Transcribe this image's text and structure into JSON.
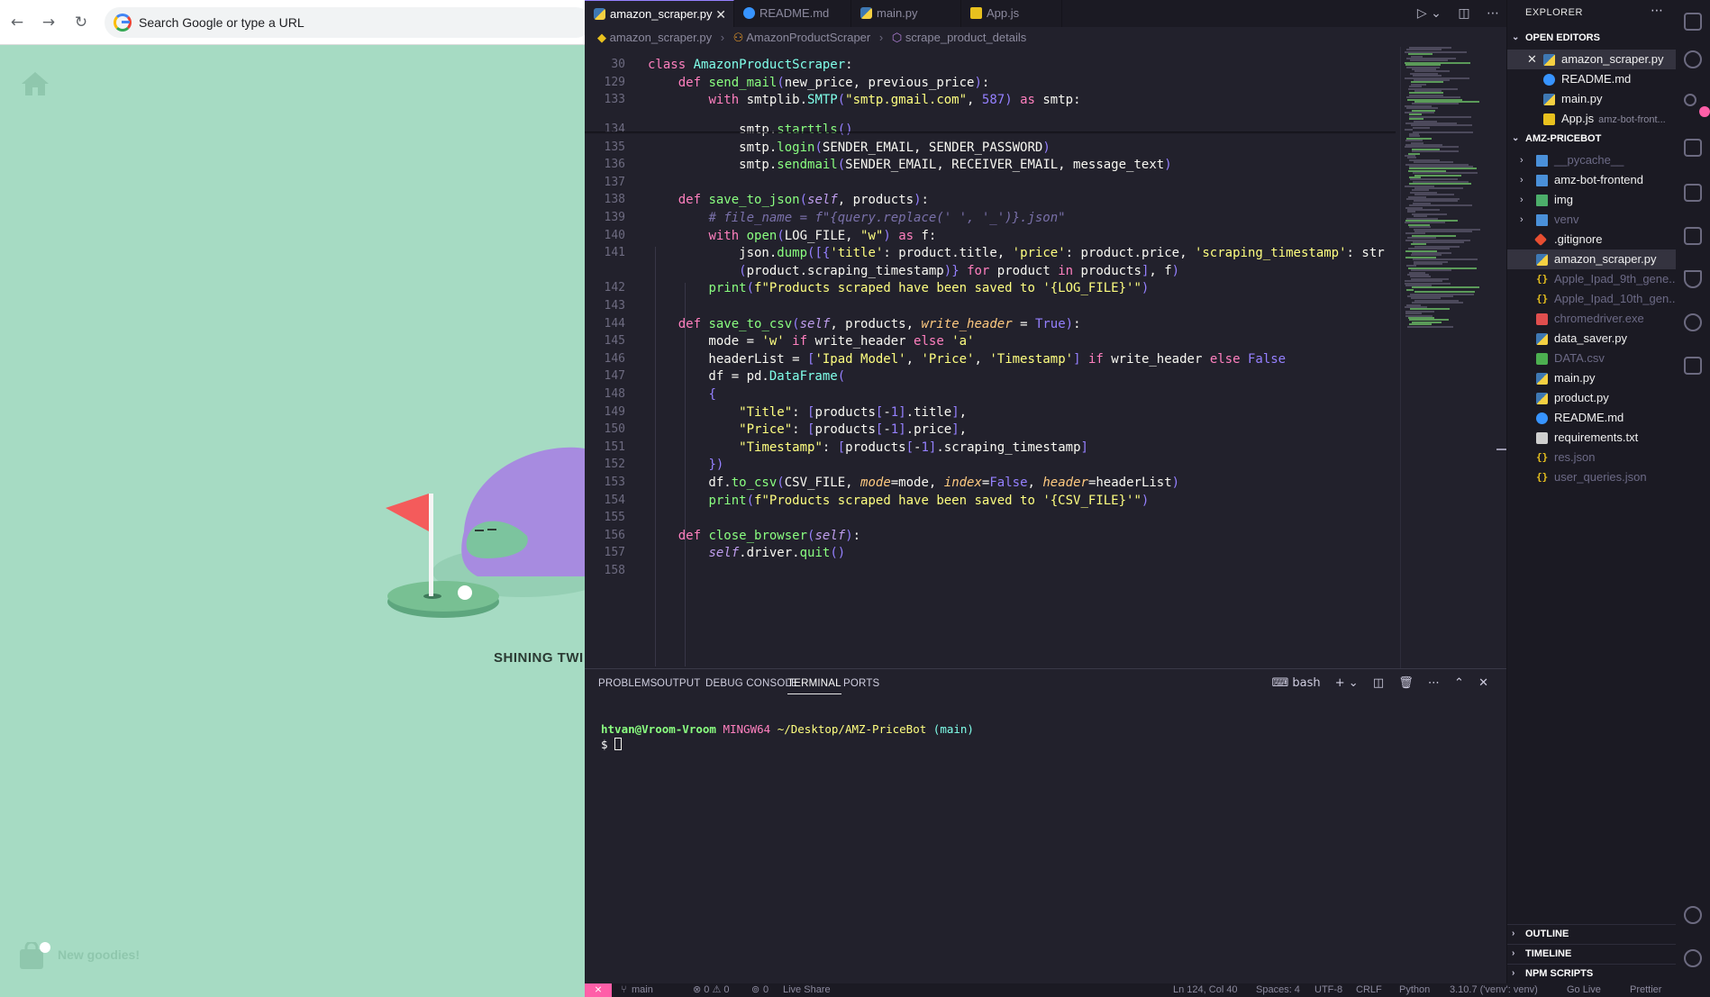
{
  "browser": {
    "omnibox_placeholder": "Search Google or type a URL",
    "back_icon": "arrow-left-icon",
    "forward_icon": "arrow-right-icon",
    "reload_icon": "reload-icon",
    "dino_title": "SHINING TWI",
    "new_goodies": "New goodies!"
  },
  "editor": {
    "tabs": [
      {
        "label": "amazon_scraper.py",
        "icon": "python-icon",
        "active": true
      },
      {
        "label": "README.md",
        "icon": "info-icon"
      },
      {
        "label": "main.py",
        "icon": "python-icon"
      },
      {
        "label": "App.js",
        "icon": "javascript-icon"
      }
    ],
    "breadcrumb": [
      "amazon_scraper.py",
      "AmazonProductScraper",
      "scrape_product_details"
    ],
    "sticky_lines": [
      {
        "num": "30",
        "text": "class AmazonProductScraper:"
      },
      {
        "num": "129",
        "text": "    def send_mail(new_price, previous_price):"
      },
      {
        "num": "133",
        "text": "        with smtplib.SMTP(\"smtp.gmail.com\", 587) as smtp:"
      }
    ],
    "lines": [
      {
        "num": "134",
        "text": "            smtp.starttls()"
      },
      {
        "num": "135",
        "text": "            smtp.login(SENDER_EMAIL, SENDER_PASSWORD)"
      },
      {
        "num": "136",
        "text": "            smtp.sendmail(SENDER_EMAIL, RECEIVER_EMAIL, message_text)"
      },
      {
        "num": "137",
        "text": ""
      },
      {
        "num": "138",
        "text": "    def save_to_json(self, products):"
      },
      {
        "num": "139",
        "text": "        # file_name = f\"{query.replace(' ', '_')}.json\""
      },
      {
        "num": "140",
        "text": "        with open(LOG_FILE, \"w\") as f:"
      },
      {
        "num": "141",
        "text": "            json.dump([{'title': product.title, 'price': product.price, 'scraping_timestamp': str"
      },
      {
        "num": "",
        "text": "            (product.scraping_timestamp)} for product in products], f)"
      },
      {
        "num": "142",
        "text": "        print(f\"Products scraped have been saved to '{LOG_FILE}'\")"
      },
      {
        "num": "143",
        "text": ""
      },
      {
        "num": "144",
        "text": "    def save_to_csv(self, products, write_header = True):"
      },
      {
        "num": "145",
        "text": "        mode = 'w' if write_header else 'a'"
      },
      {
        "num": "146",
        "text": "        headerList = ['Ipad Model', 'Price', 'Timestamp'] if write_header else False"
      },
      {
        "num": "147",
        "text": "        df = pd.DataFrame("
      },
      {
        "num": "148",
        "text": "        {"
      },
      {
        "num": "149",
        "text": "            \"Title\": [products[-1].title],"
      },
      {
        "num": "150",
        "text": "            \"Price\": [products[-1].price],"
      },
      {
        "num": "151",
        "text": "            \"Timestamp\": [products[-1].scraping_timestamp]"
      },
      {
        "num": "152",
        "text": "        })"
      },
      {
        "num": "153",
        "text": "        df.to_csv(CSV_FILE, mode=mode, index=False, header=headerList)"
      },
      {
        "num": "154",
        "text": "        print(f\"Products scraped have been saved to '{CSV_FILE}'\")"
      },
      {
        "num": "155",
        "text": ""
      },
      {
        "num": "156",
        "text": "    def close_browser(self):"
      },
      {
        "num": "157",
        "text": "        self.driver.quit()"
      },
      {
        "num": "158",
        "text": ""
      }
    ]
  },
  "panel": {
    "tabs": [
      "PROBLEMS",
      "OUTPUT",
      "DEBUG CONSOLE",
      "TERMINAL",
      "PORTS"
    ],
    "active_tab": "TERMINAL",
    "shell": "bash",
    "terminal": {
      "user": "htvan@Vroom-Vroom",
      "env": "MINGW64",
      "path": "~/Desktop/AMZ-PriceBot",
      "branch": "(main)",
      "prompt": "$"
    }
  },
  "explorer": {
    "title": "EXPLORER",
    "open_editors_label": "OPEN EDITORS",
    "open_editors": [
      {
        "label": "amazon_scraper.py",
        "icon": "python-icon",
        "desc": ""
      },
      {
        "label": "README.md",
        "icon": "info-icon",
        "desc": ""
      },
      {
        "label": "main.py",
        "icon": "python-icon",
        "desc": ""
      },
      {
        "label": "App.js",
        "icon": "javascript-icon",
        "desc": "amz-bot-front..."
      }
    ],
    "project_label": "AMZ-PRICEBOT",
    "files": [
      {
        "label": "__pycache__",
        "icon": "folder-icon",
        "folder": true,
        "dim": true
      },
      {
        "label": "amz-bot-frontend",
        "icon": "folder-icon",
        "folder": true
      },
      {
        "label": "img",
        "icon": "image-folder-icon",
        "folder": true
      },
      {
        "label": "venv",
        "icon": "folder-icon",
        "folder": true,
        "dim": true
      },
      {
        "label": ".gitignore",
        "icon": "git-icon"
      },
      {
        "label": "amazon_scraper.py",
        "icon": "python-icon",
        "selected": true
      },
      {
        "label": "Apple_Ipad_9th_gene...",
        "icon": "json-icon",
        "dim": true
      },
      {
        "label": "Apple_Ipad_10th_gen...",
        "icon": "json-icon",
        "dim": true
      },
      {
        "label": "chromedriver.exe",
        "icon": "exe-icon",
        "dim": true
      },
      {
        "label": "data_saver.py",
        "icon": "python-icon"
      },
      {
        "label": "DATA.csv",
        "icon": "csv-icon",
        "dim": true
      },
      {
        "label": "main.py",
        "icon": "python-icon"
      },
      {
        "label": "product.py",
        "icon": "python-icon"
      },
      {
        "label": "README.md",
        "icon": "info-icon"
      },
      {
        "label": "requirements.txt",
        "icon": "text-file-icon"
      },
      {
        "label": "res.json",
        "icon": "json-icon",
        "dim": true
      },
      {
        "label": "user_queries.json",
        "icon": "json-icon",
        "dim": true
      }
    ],
    "bottom_sections": [
      "OUTLINE",
      "TIMELINE",
      "NPM SCRIPTS"
    ]
  },
  "statusbar": {
    "branch": "main",
    "problems": "⊗ 0 ⚠ 0",
    "ports": "0",
    "live_share": "Live Share",
    "position": "Ln 124, Col 40",
    "spaces": "Spaces: 4",
    "encoding": "UTF-8",
    "eol": "CRLF",
    "language": "Python",
    "interpreter": "3.10.7 ('venv': venv)",
    "go_live": "Go Live",
    "prettier": "Prettier"
  },
  "colors": {
    "browser_bg": "#a6dbc3",
    "editor_bg": "#22212c",
    "accent_pink": "#ff80bf",
    "accent_green": "#8aff80"
  }
}
